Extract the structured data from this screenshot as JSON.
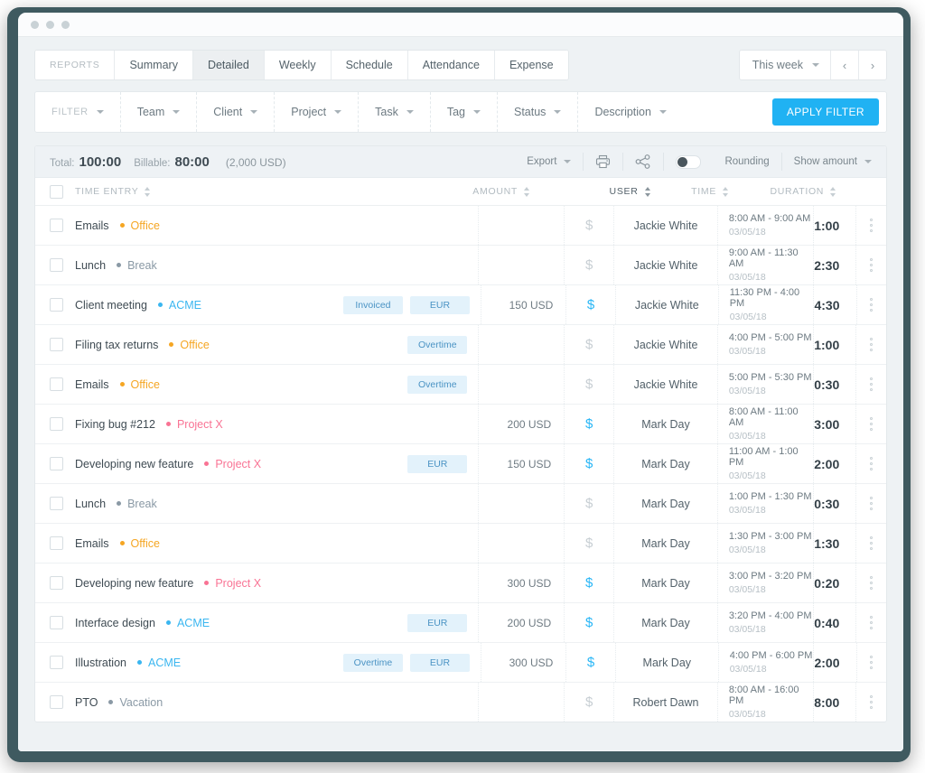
{
  "window": {
    "dots": 3
  },
  "tabs": {
    "label_reports": "REPORTS",
    "items": [
      {
        "label": "Summary",
        "active": false
      },
      {
        "label": "Detailed",
        "active": true
      },
      {
        "label": "Weekly",
        "active": false
      },
      {
        "label": "Schedule",
        "active": false
      },
      {
        "label": "Attendance",
        "active": false
      },
      {
        "label": "Expense",
        "active": false
      }
    ]
  },
  "daterange": {
    "value": "This week",
    "prev": "‹",
    "next": "›"
  },
  "filterbar": {
    "label": "FILTER",
    "items": [
      "Team",
      "Client",
      "Project",
      "Task",
      "Tag",
      "Status",
      "Description"
    ],
    "apply_label": "APPLY FILTER"
  },
  "summary": {
    "total_label": "Total:",
    "total_value": "100:00",
    "billable_label": "Billable:",
    "billable_value": "80:00",
    "billable_money": "(2,000 USD)",
    "export_label": "Export",
    "print_icon": "printer-icon",
    "share_icon": "share-icon",
    "rounding_label": "Rounding",
    "rounding_on": false,
    "show_amount_label": "Show amount"
  },
  "columns": {
    "entry": "TIME ENTRY",
    "amount": "AMOUNT",
    "user": "USER",
    "time": "TIME",
    "duration": "DURATION",
    "user_sort_active": true
  },
  "colors": {
    "accent": "#20b2f3",
    "billable": "#29b6f6",
    "badge_bg": "#e3f2fb",
    "badge_text": "#4a93c4",
    "project_office": "#f5a623",
    "project_break": "#8a99a5",
    "project_acme": "#3ab6f0",
    "project_x": "#f97394",
    "project_vacation": "#8a99a5",
    "frame": "#3f5a60",
    "page_bg": "#eef2f4"
  },
  "rows": [
    {
      "name": "Emails",
      "project": "Office",
      "project_color": "#f5a623",
      "badges": [],
      "amount": "",
      "billable": false,
      "user": "Jackie White",
      "time": "8:00 AM - 9:00 AM",
      "date": "03/05/18",
      "duration": "1:00"
    },
    {
      "name": "Lunch",
      "project": "Break",
      "project_color": "#8a99a5",
      "badges": [],
      "amount": "",
      "billable": false,
      "user": "Jackie White",
      "time": "9:00 AM - 11:30 AM",
      "date": "03/05/18",
      "duration": "2:30"
    },
    {
      "name": "Client meeting",
      "project": "ACME",
      "project_color": "#3ab6f0",
      "badges": [
        "Invoiced",
        "EUR"
      ],
      "amount": "150 USD",
      "billable": true,
      "user": "Jackie White",
      "time": "11:30 PM - 4:00 PM",
      "date": "03/05/18",
      "duration": "4:30"
    },
    {
      "name": "Filing tax returns",
      "project": "Office",
      "project_color": "#f5a623",
      "badges": [
        "Overtime"
      ],
      "amount": "",
      "billable": false,
      "user": "Jackie White",
      "time": "4:00 PM - 5:00 PM",
      "date": "03/05/18",
      "duration": "1:00"
    },
    {
      "name": "Emails",
      "project": "Office",
      "project_color": "#f5a623",
      "badges": [
        "Overtime"
      ],
      "amount": "",
      "billable": false,
      "user": "Jackie White",
      "time": "5:00 PM - 5:30 PM",
      "date": "03/05/18",
      "duration": "0:30"
    },
    {
      "name": "Fixing bug #212",
      "project": "Project X",
      "project_color": "#f97394",
      "badges": [],
      "amount": "200 USD",
      "billable": true,
      "user": "Mark Day",
      "time": "8:00 AM - 11:00 AM",
      "date": "03/05/18",
      "duration": "3:00"
    },
    {
      "name": "Developing new feature",
      "project": "Project X",
      "project_color": "#f97394",
      "badges": [
        "EUR"
      ],
      "amount": "150 USD",
      "billable": true,
      "user": "Mark Day",
      "time": "11:00 AM - 1:00 PM",
      "date": "03/05/18",
      "duration": "2:00"
    },
    {
      "name": "Lunch",
      "project": "Break",
      "project_color": "#8a99a5",
      "badges": [],
      "amount": "",
      "billable": false,
      "user": "Mark Day",
      "time": "1:00 PM - 1:30 PM",
      "date": "03/05/18",
      "duration": "0:30"
    },
    {
      "name": "Emails",
      "project": "Office",
      "project_color": "#f5a623",
      "badges": [],
      "amount": "",
      "billable": false,
      "user": "Mark Day",
      "time": "1:30 PM - 3:00 PM",
      "date": "03/05/18",
      "duration": "1:30"
    },
    {
      "name": "Developing new feature",
      "project": "Project X",
      "project_color": "#f97394",
      "badges": [],
      "amount": "300 USD",
      "billable": true,
      "user": "Mark Day",
      "time": "3:00 PM - 3:20 PM",
      "date": "03/05/18",
      "duration": "0:20"
    },
    {
      "name": "Interface design",
      "project": "ACME",
      "project_color": "#3ab6f0",
      "badges": [
        "EUR"
      ],
      "amount": "200 USD",
      "billable": true,
      "user": "Mark Day",
      "time": "3:20 PM - 4:00 PM",
      "date": "03/05/18",
      "duration": "0:40"
    },
    {
      "name": "Illustration",
      "project": "ACME",
      "project_color": "#3ab6f0",
      "badges": [
        "Overtime",
        "EUR"
      ],
      "amount": "300 USD",
      "billable": true,
      "user": "Mark Day",
      "time": "4:00 PM - 6:00 PM",
      "date": "03/05/18",
      "duration": "2:00"
    },
    {
      "name": "PTO",
      "project": "Vacation",
      "project_color": "#8a99a5",
      "badges": [],
      "amount": "",
      "billable": false,
      "user": "Robert Dawn",
      "time": "8:00 AM - 16:00 PM",
      "date": "03/05/18",
      "duration": "8:00"
    }
  ]
}
